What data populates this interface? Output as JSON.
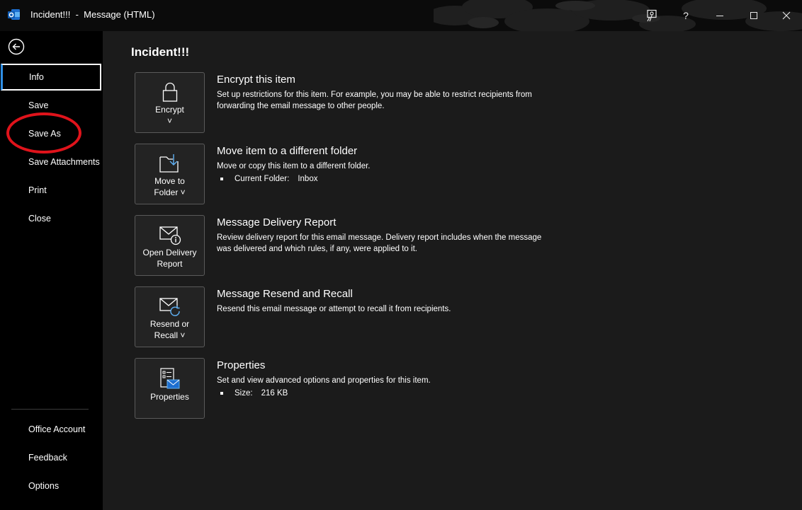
{
  "window": {
    "title": "Incident!!!  -  Message (HTML)",
    "controls": [
      "coach-icon",
      "help",
      "minimize",
      "maximize",
      "close"
    ],
    "help_label": "?"
  },
  "sidebar": {
    "items": [
      {
        "label": "Info",
        "active": true
      },
      {
        "label": "Save"
      },
      {
        "label": "Save As",
        "annotated": true
      },
      {
        "label": "Save Attachments"
      },
      {
        "label": "Print"
      },
      {
        "label": "Close"
      }
    ],
    "footer_items": [
      {
        "label": "Office Account"
      },
      {
        "label": "Feedback"
      },
      {
        "label": "Options"
      }
    ]
  },
  "main": {
    "title": "Incident!!!",
    "cards": [
      {
        "tile_label": "Encrypt\n˅",
        "icon": "lock-icon",
        "title": "Encrypt this item",
        "description": "Set up restrictions for this item. For example, you may be able to restrict recipients from forwarding the email message to other people."
      },
      {
        "tile_label": "Move to\nFolder ˅",
        "icon": "move-folder-icon",
        "title": "Move item to a different folder",
        "description": "Move or copy this item to a different folder.",
        "bullet_key": "Current Folder:",
        "bullet_value": "Inbox"
      },
      {
        "tile_label": "Open Delivery\nReport",
        "icon": "delivery-report-icon",
        "title": "Message Delivery Report",
        "description": "Review delivery report for this email message. Delivery report includes when the message was delivered and which rules, if any, were applied to it."
      },
      {
        "tile_label": "Resend or\nRecall ˅",
        "icon": "resend-icon",
        "title": "Message Resend and Recall",
        "description": "Resend this email message or attempt to recall it from recipients."
      },
      {
        "tile_label": "Properties",
        "icon": "properties-icon",
        "title": "Properties",
        "description": "Set and view advanced options and properties for this item.",
        "bullet_key": "Size:",
        "bullet_value": "216 KB"
      }
    ]
  },
  "colors": {
    "accent": "#2f8fe6",
    "annotation": "#e0131b",
    "sidebar_bg": "#000000",
    "main_bg": "#1b1b1b"
  }
}
